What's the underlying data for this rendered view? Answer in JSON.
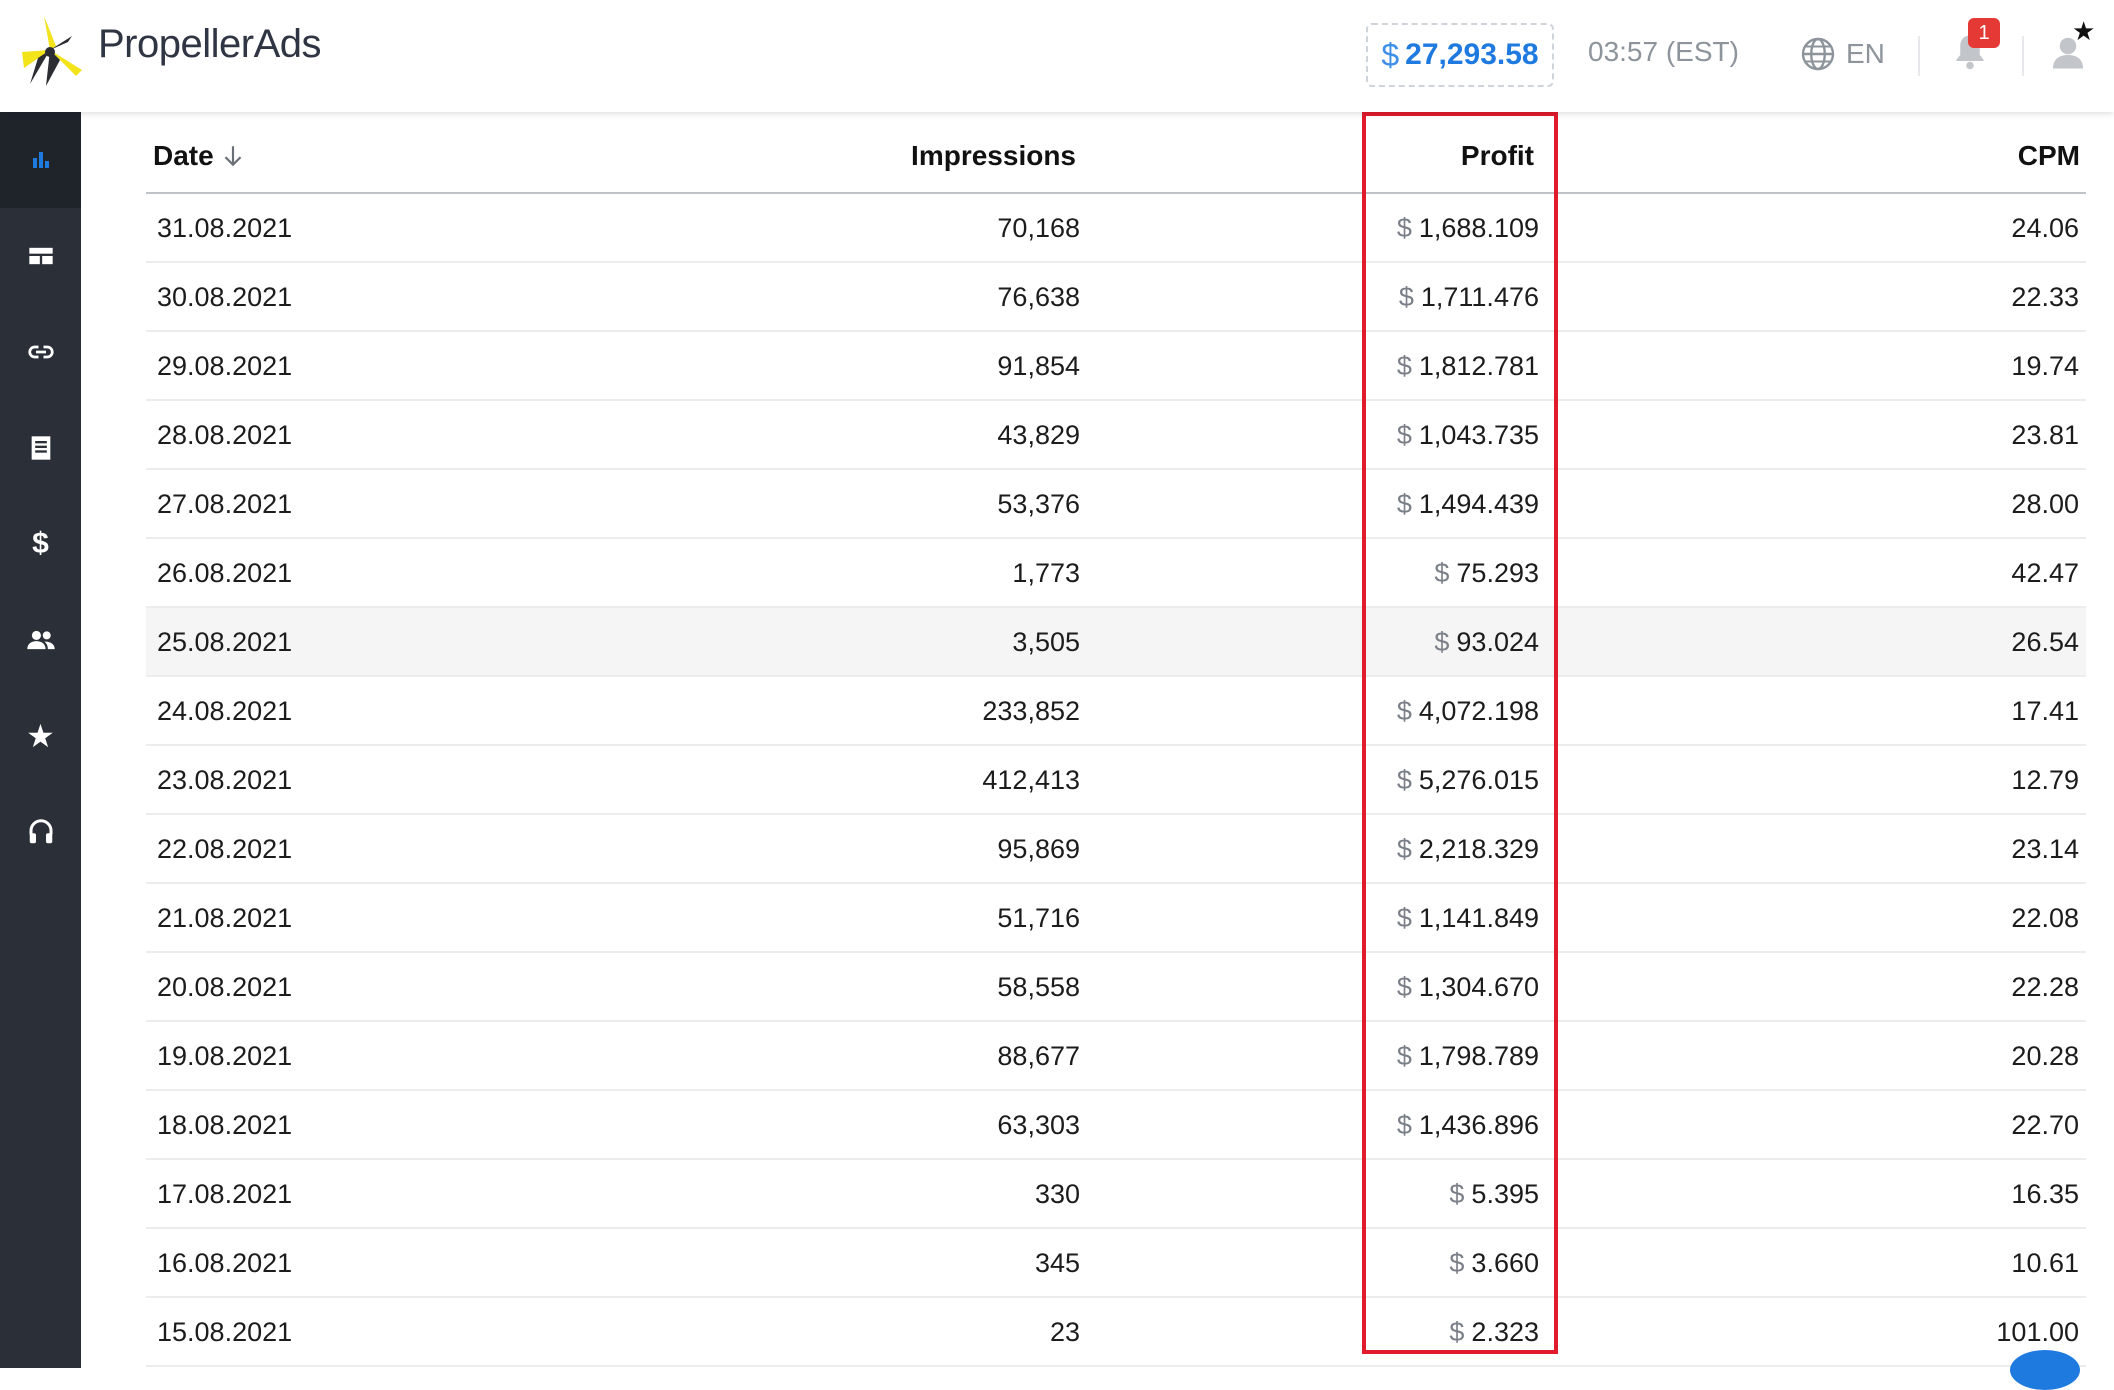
{
  "brand": {
    "name": "PropellerAds"
  },
  "header": {
    "balance_currency": "$",
    "balance_amount": "27,293.58",
    "time": "03:57 (EST)",
    "language": "EN",
    "notification_count": "1"
  },
  "sidebar": {
    "items": [
      {
        "name": "statistics",
        "icon": "bar-chart-icon",
        "active": true
      },
      {
        "name": "ad-zones",
        "icon": "dashboard-icon",
        "active": false
      },
      {
        "name": "direct-links",
        "icon": "link-icon",
        "active": false
      },
      {
        "name": "reports",
        "icon": "receipt-icon",
        "active": false
      },
      {
        "name": "payments",
        "icon": "dollar-icon",
        "active": false
      },
      {
        "name": "referrals",
        "icon": "people-icon",
        "active": false
      },
      {
        "name": "favorites",
        "icon": "star-icon",
        "active": false
      },
      {
        "name": "support",
        "icon": "headset-icon",
        "active": false
      }
    ]
  },
  "table": {
    "columns": {
      "date": "Date",
      "impressions": "Impressions",
      "profit": "Profit",
      "cpm": "CPM"
    },
    "currency": "$",
    "rows": [
      {
        "date": "31.08.2021",
        "impressions": "70,168",
        "profit": "1,688.109",
        "cpm": "24.06"
      },
      {
        "date": "30.08.2021",
        "impressions": "76,638",
        "profit": "1,711.476",
        "cpm": "22.33"
      },
      {
        "date": "29.08.2021",
        "impressions": "91,854",
        "profit": "1,812.781",
        "cpm": "19.74"
      },
      {
        "date": "28.08.2021",
        "impressions": "43,829",
        "profit": "1,043.735",
        "cpm": "23.81"
      },
      {
        "date": "27.08.2021",
        "impressions": "53,376",
        "profit": "1,494.439",
        "cpm": "28.00"
      },
      {
        "date": "26.08.2021",
        "impressions": "1,773",
        "profit": "75.293",
        "cpm": "42.47"
      },
      {
        "date": "25.08.2021",
        "impressions": "3,505",
        "profit": "93.024",
        "cpm": "26.54"
      },
      {
        "date": "24.08.2021",
        "impressions": "233,852",
        "profit": "4,072.198",
        "cpm": "17.41"
      },
      {
        "date": "23.08.2021",
        "impressions": "412,413",
        "profit": "5,276.015",
        "cpm": "12.79"
      },
      {
        "date": "22.08.2021",
        "impressions": "95,869",
        "profit": "2,218.329",
        "cpm": "23.14"
      },
      {
        "date": "21.08.2021",
        "impressions": "51,716",
        "profit": "1,141.849",
        "cpm": "22.08"
      },
      {
        "date": "20.08.2021",
        "impressions": "58,558",
        "profit": "1,304.670",
        "cpm": "22.28"
      },
      {
        "date": "19.08.2021",
        "impressions": "88,677",
        "profit": "1,798.789",
        "cpm": "20.28"
      },
      {
        "date": "18.08.2021",
        "impressions": "63,303",
        "profit": "1,436.896",
        "cpm": "22.70"
      },
      {
        "date": "17.08.2021",
        "impressions": "330",
        "profit": "5.395",
        "cpm": "16.35"
      },
      {
        "date": "16.08.2021",
        "impressions": "345",
        "profit": "3.660",
        "cpm": "10.61"
      },
      {
        "date": "15.08.2021",
        "impressions": "23",
        "profit": "2.323",
        "cpm": "101.00"
      }
    ]
  },
  "colors": {
    "accent": "#1f7ae0",
    "sidebar_bg": "#2a2f38",
    "highlight_box": "#e01b2c",
    "badge": "#e53935"
  }
}
